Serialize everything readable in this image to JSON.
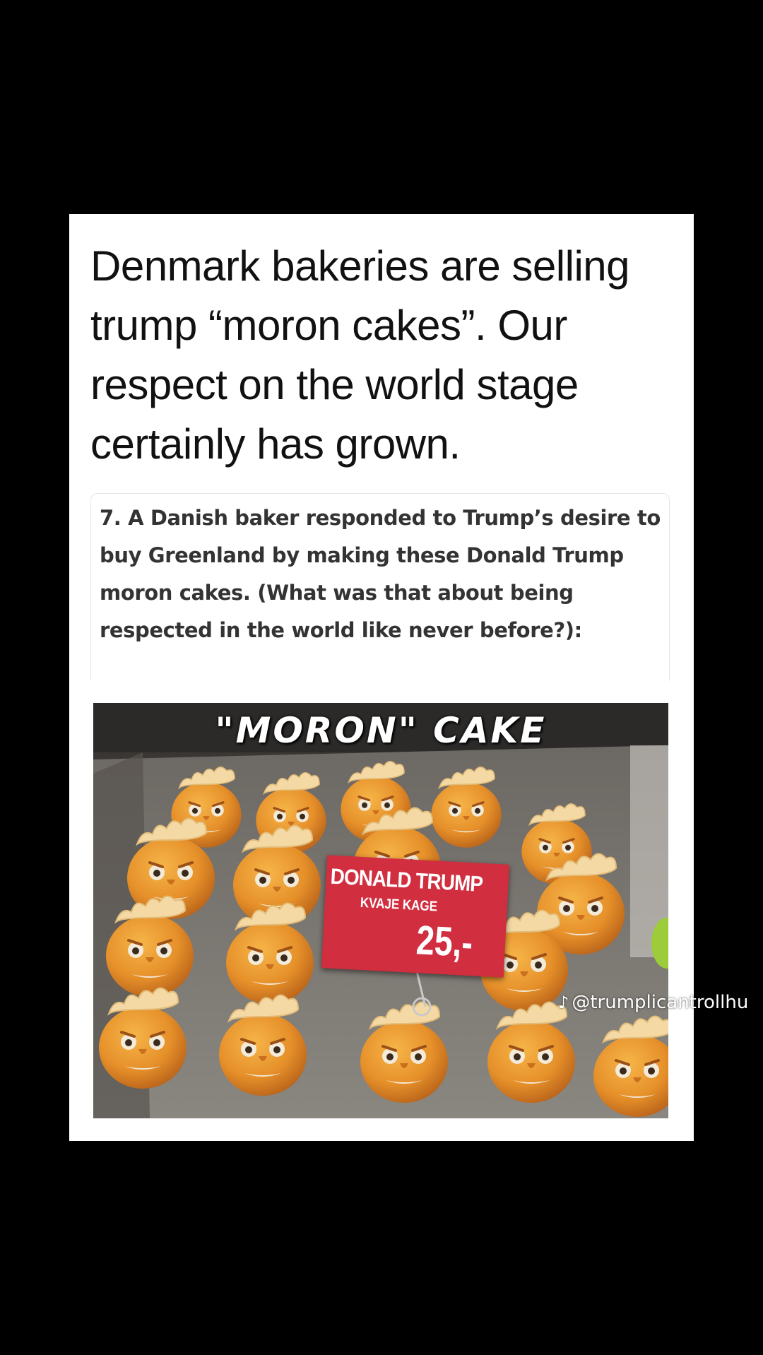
{
  "post": {
    "headline": "Denmark bakeries are selling trump “moron cakes”. Our respect on the world stage certainly has grown.",
    "quote": "7. A Danish baker responded to Trump’s desire to buy Greenland by making these Donald Trump moron cakes. (What was that about being respected in the world like never before?):"
  },
  "photo": {
    "caption": "\"MORON\" CAKE",
    "sign_title": "DONALD TRUMP",
    "sign_subtitle": "KVAJE KAGE",
    "sign_price": "25,-"
  },
  "watermark": {
    "icon": "tiktok-icon",
    "handle": "@trumplicantrollhu"
  },
  "colors": {
    "background": "#000000",
    "card": "#ffffff",
    "sign": "#d12e3f",
    "cake": "#e8962c"
  }
}
